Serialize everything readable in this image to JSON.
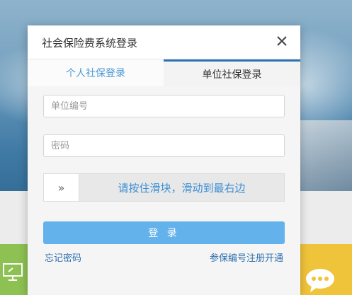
{
  "modal": {
    "title": "社会保险费系统登录",
    "close_icon": "close-icon"
  },
  "tabs": [
    {
      "label": "个人社保登录",
      "active": false
    },
    {
      "label": "单位社保登录",
      "active": true
    }
  ],
  "form": {
    "username_placeholder": "单位编号",
    "password_placeholder": "密码",
    "username_value": "",
    "password_value": ""
  },
  "slider": {
    "handle_icon": "double-chevron-right-icon",
    "handle_glyph": "»",
    "text": "请按住滑块，滑动到最右边"
  },
  "login_button": "登 录",
  "links": {
    "forgot": "忘记密码",
    "register": "参保编号注册开通"
  },
  "background": {
    "tile_icon": "monitor-icon",
    "chat_icon": "chat-bubble-icon"
  },
  "colors": {
    "accent": "#2a74b6",
    "button": "#64b2ec",
    "link": "#2f6fae",
    "slider_text": "#3b8ed3",
    "tile_green": "#8dc152",
    "tile_yellow": "#f0c43a"
  }
}
